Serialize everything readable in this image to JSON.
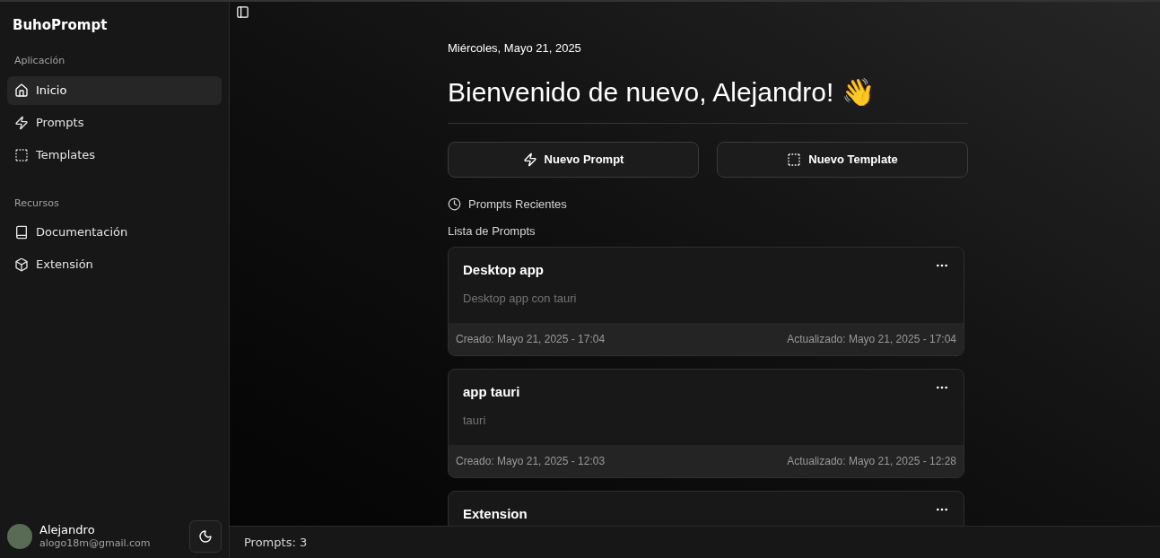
{
  "sidebar": {
    "brand": "BuhoPrompt",
    "groups": [
      {
        "label": "Aplicación",
        "items": [
          {
            "label": "Inicio",
            "kind": "home",
            "selected": true
          },
          {
            "label": "Prompts",
            "kind": "prompts",
            "selected": false
          },
          {
            "label": "Templates",
            "kind": "templates",
            "selected": false
          }
        ]
      },
      {
        "label": "Recursos",
        "items": [
          {
            "label": "Documentación",
            "kind": "docs",
            "selected": false
          },
          {
            "label": "Extensión",
            "kind": "extension",
            "selected": false
          }
        ]
      }
    ],
    "user": {
      "name": "Alejandro",
      "email": "alogo18m@gmail.com"
    }
  },
  "main": {
    "date": "Miércoles, Mayo 21, 2025",
    "heading": "Bienvenido de nuevo, Alejandro! 👋",
    "actions": [
      {
        "label": "Nuevo Prompt",
        "kind": "prompts"
      },
      {
        "label": "Nuevo Template",
        "kind": "templates"
      }
    ],
    "recent_title": "Prompts Recientes",
    "list_title": "Lista de Prompts",
    "prompts": [
      {
        "title": "Desktop app",
        "description": "Desktop app con tauri",
        "created": "Creado: Mayo 21, 2025 - 17:04",
        "updated": "Actualizado: Mayo 21, 2025 - 17:04"
      },
      {
        "title": "app tauri",
        "description": "tauri",
        "created": "Creado: Mayo 21, 2025 - 12:03",
        "updated": "Actualizado: Mayo 21, 2025 - 12:28"
      },
      {
        "title": "Extension"
      }
    ]
  },
  "status_bar": {
    "text": "Prompts: 3"
  }
}
